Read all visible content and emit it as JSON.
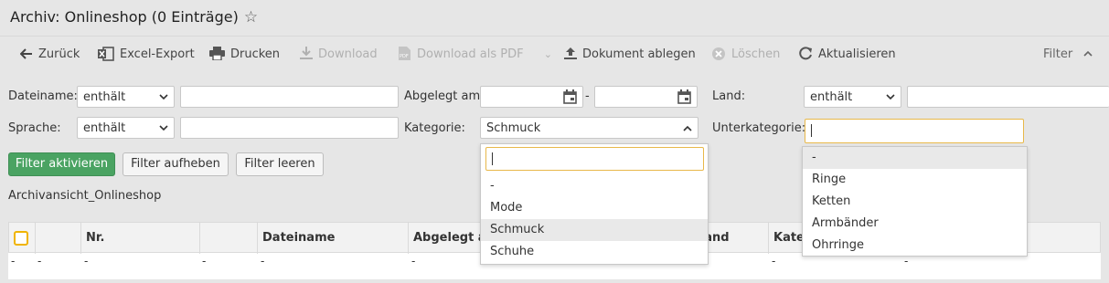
{
  "header": {
    "title": "Archiv: Onlineshop (0 Einträge)",
    "star_icon": "star-outline-icon"
  },
  "toolbar": {
    "back": "Zurück",
    "excel": "Excel-Export",
    "print": "Drucken",
    "download": "Download",
    "download_pdf": "Download als PDF",
    "upload": "Dokument ablegen",
    "delete": "Löschen",
    "refresh": "Aktualisieren",
    "filter": "Filter"
  },
  "filters": {
    "dateiname_label": "Dateiname:",
    "dateiname_mode": "enthält",
    "dateiname_value": "",
    "abgelegt_label": "Abgelegt am:",
    "date_separator": "-",
    "land_label": "Land:",
    "land_mode": "enthält",
    "land_value": "",
    "sprache_label": "Sprache:",
    "sprache_mode": "enthält",
    "sprache_value": "",
    "kategorie_label": "Kategorie:",
    "kategorie_value": "Schmuck",
    "unterkategorie_label": "Unterkategorie:",
    "unterkategorie_value": ""
  },
  "buttons": {
    "activate": "Filter aktivieren",
    "remove": "Filter aufheben",
    "clear": "Filter leeren"
  },
  "view_name": "Archivansicht_Onlineshop",
  "table": {
    "headers": [
      "Nr.",
      "Dateiname",
      "Abgelegt am",
      "Land",
      "Kategorie"
    ],
    "row": [
      "-",
      "-",
      "-",
      "-",
      "-",
      "-",
      "-",
      "-",
      "-",
      "-"
    ]
  },
  "kategorie_dropdown": {
    "search": "",
    "options": [
      "-",
      "Mode",
      "Schmuck",
      "Schuhe"
    ],
    "highlighted": "Schmuck"
  },
  "unterkategorie_dropdown": {
    "options": [
      "-",
      "Ringe",
      "Ketten",
      "Armbänder",
      "Ohrringe"
    ],
    "highlighted": "-"
  },
  "colors": {
    "primary_button": "#4aa362",
    "focus_border": "#e8b84a",
    "checkbox": "#f0b400"
  }
}
